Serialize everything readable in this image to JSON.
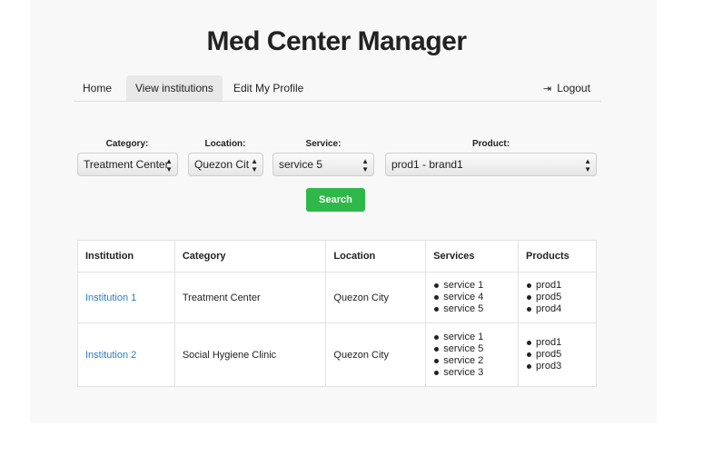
{
  "app_title": "Med Center Manager",
  "nav": {
    "home": "Home",
    "view_institutions": "View institutions",
    "edit_profile": "Edit My Profile",
    "logout": "Logout"
  },
  "filters": {
    "category": {
      "label": "Category:",
      "value": "Treatment Center"
    },
    "location": {
      "label": "Location:",
      "value": "Quezon City"
    },
    "service": {
      "label": "Service:",
      "value": "service 5"
    },
    "product": {
      "label": "Product:",
      "value": "prod1 - brand1"
    }
  },
  "search_label": "Search",
  "table": {
    "headers": [
      "Institution",
      "Category",
      "Location",
      "Services",
      "Products"
    ],
    "rows": [
      {
        "institution": "Institution 1",
        "category": "Treatment Center",
        "location": "Quezon City",
        "services": [
          "service 1",
          "service 4",
          "service 5"
        ],
        "products": [
          "prod1",
          "prod5",
          "prod4"
        ]
      },
      {
        "institution": "Institution 2",
        "category": "Social Hygiene Clinic",
        "location": "Quezon City",
        "services": [
          "service 1",
          "service 5",
          "service 2",
          "service 3"
        ],
        "products": [
          "prod1",
          "prod5",
          "prod3"
        ]
      }
    ]
  },
  "colors": {
    "accent_green": "#2fb84a",
    "link_blue": "#2d7ec4"
  }
}
